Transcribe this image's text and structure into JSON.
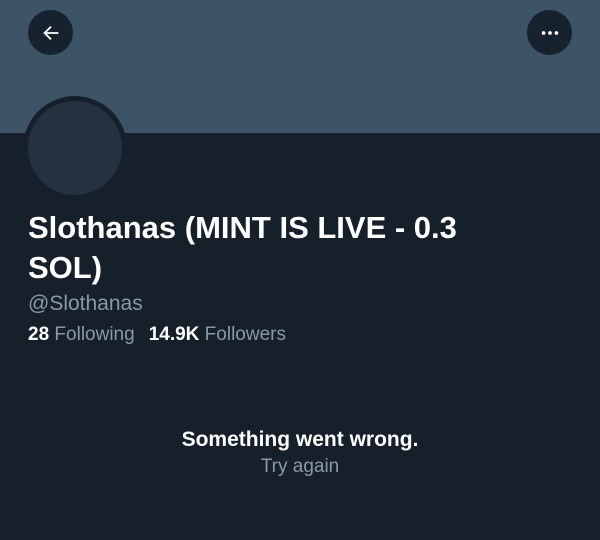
{
  "header": {
    "back_icon": "arrow-left-icon",
    "more_icon": "more-horizontal-icon"
  },
  "profile": {
    "display_name": "Slothanas (MINT IS LIVE - 0.3 SOL)",
    "handle": "@Slothanas",
    "following_count": "28",
    "following_label": "Following",
    "followers_count": "14.9K",
    "followers_label": "Followers"
  },
  "error": {
    "message": "Something went wrong.",
    "retry_label": "Try again"
  },
  "colors": {
    "background": "#15202b",
    "banner": "#3d5466",
    "secondary_text": "#8b98a5"
  }
}
